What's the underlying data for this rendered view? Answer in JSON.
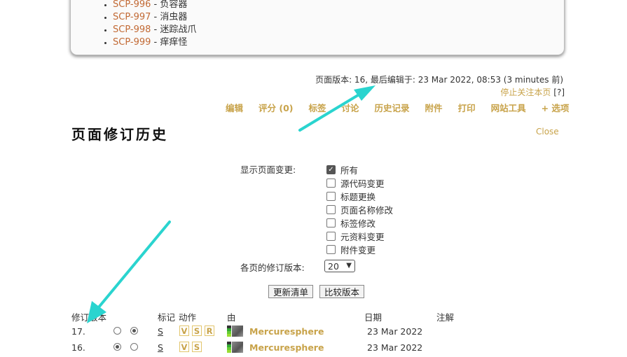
{
  "scp_list": [
    {
      "code": "SCP-996",
      "name": "负容器"
    },
    {
      "code": "SCP-997",
      "name": "消虫器"
    },
    {
      "code": "SCP-998",
      "name": "迷踪战爪"
    },
    {
      "code": "SCP-999",
      "name": "痒痒怪"
    }
  ],
  "page_info": "页面版本: 16, 最后编辑于: 23 Mar 2022, 08:53 (3 minutes 前)",
  "unwatch": {
    "label": "停止关注本页",
    "help": "[?]"
  },
  "actions": [
    "编辑",
    "评分 (0)",
    "标签",
    "讨论",
    "历史记录",
    "附件",
    "打印",
    "网站工具",
    "+ 选项"
  ],
  "history": {
    "title": "页面修订历史",
    "close": "Close",
    "show_changes_label": "显示页面变更:",
    "filters": [
      {
        "label": "所有",
        "checked": true
      },
      {
        "label": "源代码变更",
        "checked": false
      },
      {
        "label": "标题更换",
        "checked": false
      },
      {
        "label": "页面名称修改",
        "checked": false
      },
      {
        "label": "标签修改",
        "checked": false
      },
      {
        "label": "元资料变更",
        "checked": false
      },
      {
        "label": "附件变更",
        "checked": false
      }
    ],
    "per_page_label": "各页的修订版本:",
    "per_page_value": "20",
    "update_button": "更新清单",
    "compare_button": "比较版本",
    "columns": {
      "rev": "修订版本",
      "flags": "标记",
      "actions": "动作",
      "by": "由",
      "date": "日期",
      "comment": "注解"
    },
    "rows": [
      {
        "rev": "17.",
        "flag": "S",
        "buttons": [
          "V",
          "S",
          "R"
        ],
        "user": "Mercuresphere",
        "date": "23 Mar 2022",
        "radio1": false,
        "radio2": true
      },
      {
        "rev": "16.",
        "flag": "S",
        "buttons": [
          "V",
          "S"
        ],
        "user": "Mercuresphere",
        "date": "23 Mar 2022",
        "radio1": true,
        "radio2": false
      }
    ]
  },
  "colors": {
    "link": "#c8a34a",
    "scp_code": "#c26a35",
    "arrow": "#2ad4cf"
  }
}
